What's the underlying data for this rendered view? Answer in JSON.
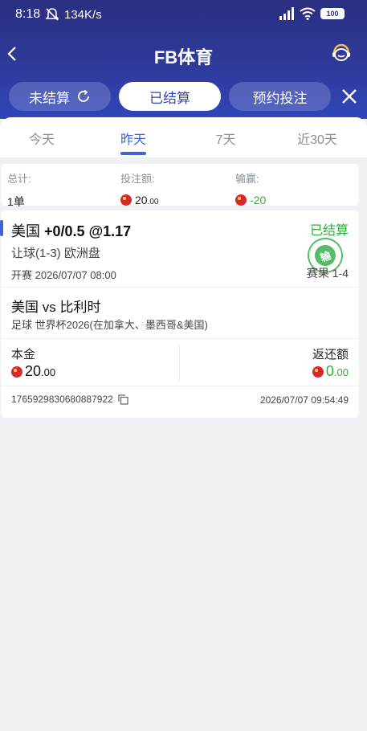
{
  "status_bar": {
    "time": "8:18",
    "speed": "134K/s",
    "battery": "100"
  },
  "header": {
    "title": "FB体育"
  },
  "filter_tabs": [
    {
      "label": "未结算",
      "active": false
    },
    {
      "label": "已结算",
      "active": true
    },
    {
      "label": "预约投注",
      "active": false
    }
  ],
  "date_tabs": [
    {
      "label": "今天",
      "active": false
    },
    {
      "label": "昨天",
      "active": true
    },
    {
      "label": "7天",
      "active": false
    },
    {
      "label": "近30天",
      "active": false
    }
  ],
  "summary": {
    "total_label": "总计:",
    "total_value": "1单",
    "stake_label": "投注额:",
    "stake_int": "20",
    "stake_dec": ".00",
    "winloss_label": "输赢:",
    "winloss_value": "-20"
  },
  "bet": {
    "team": "美国",
    "line": "+0/0.5 @1.17",
    "status": "已结算",
    "stamp_text": "输",
    "market": "让球(1-3) 欧洲盘",
    "kickoff": "开赛 2026/07/07 08:00",
    "score": "赛果 1-4",
    "match": "美国 vs 比利时",
    "league": "足球   世界杯2026(在加拿大、墨西哥&美国)",
    "principal_label": "本金",
    "principal_int": "20",
    "principal_dec": ".00",
    "return_label": "返还额",
    "return_int": "0",
    "return_dec": ".00",
    "order_id": "1765929830680887922",
    "settle_time": "2026/07/07 09:54:49"
  },
  "colors": {
    "accent": "#3d63dd",
    "win_green": "#2eaf3a",
    "header_dark": "#2a2f80"
  }
}
